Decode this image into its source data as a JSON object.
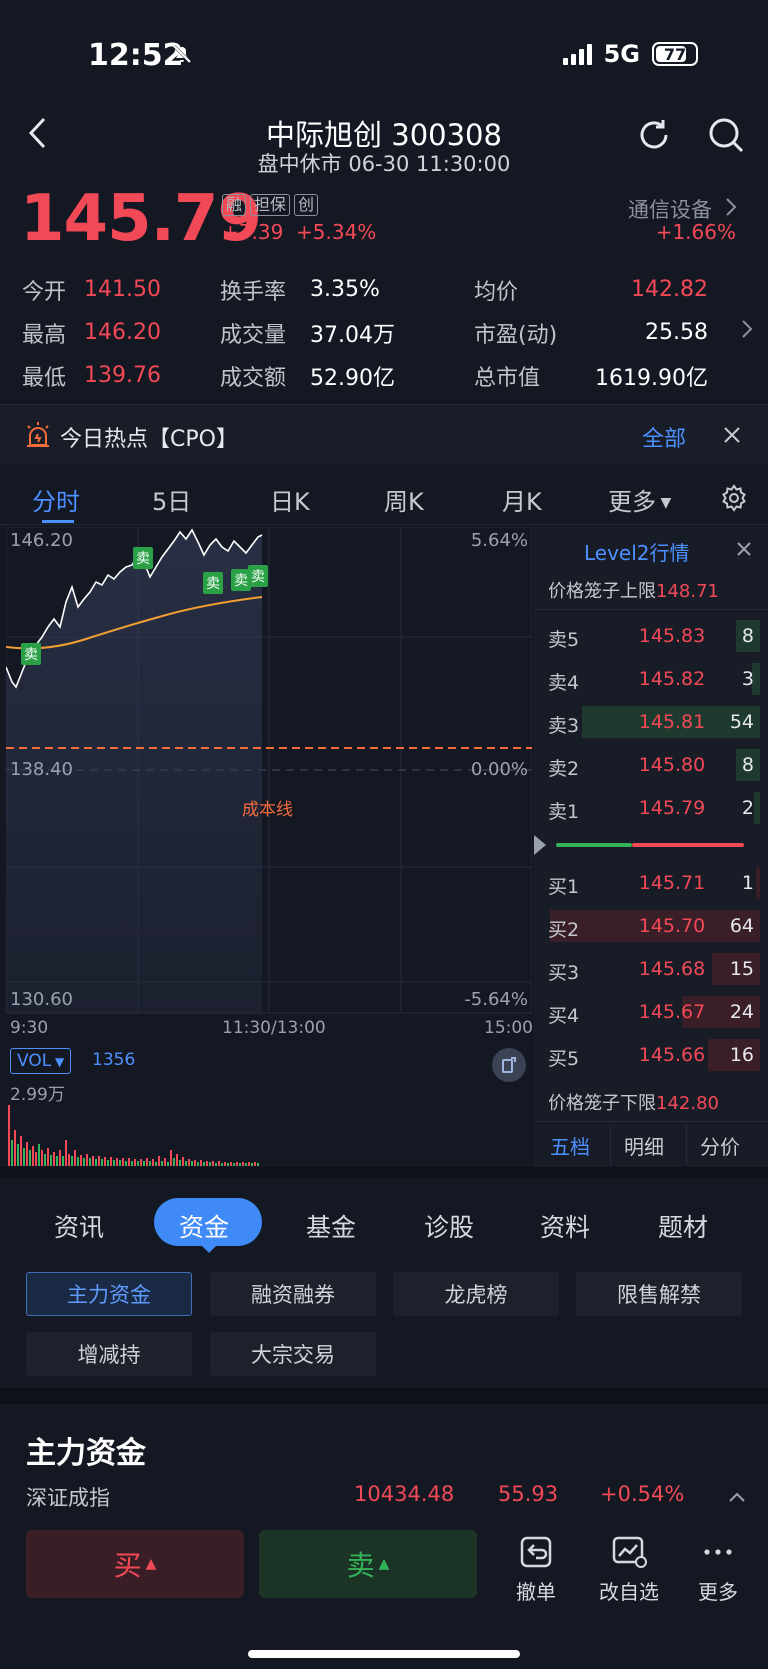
{
  "status": {
    "time": "12:52",
    "network": "5G",
    "battery": "77"
  },
  "header": {
    "title": "中际旭创 300308",
    "subtitle": "盘中休市 06-30 11:30:00"
  },
  "quote": {
    "price": "145.79",
    "badges": [
      "融",
      "担保",
      "创"
    ],
    "change": "+7.39",
    "change_pct": "+5.34%",
    "sector": "通信设备",
    "sector_chg": "+1.66%"
  },
  "stats": [
    [
      {
        "label": "今开",
        "value": "141.50",
        "color": "red"
      },
      {
        "label": "换手率",
        "value": "3.35%"
      },
      {
        "label": "均价",
        "value": "142.82",
        "color": "red"
      }
    ],
    [
      {
        "label": "最高",
        "value": "146.20",
        "color": "red"
      },
      {
        "label": "成交量",
        "value": "37.04万"
      },
      {
        "label": "市盈(动)",
        "value": "25.58"
      }
    ],
    [
      {
        "label": "最低",
        "value": "139.76",
        "color": "red"
      },
      {
        "label": "成交额",
        "value": "52.90亿"
      },
      {
        "label": "总市值",
        "value": "1619.90亿"
      }
    ]
  ],
  "hot": {
    "text": "今日热点【CPO】",
    "all": "全部"
  },
  "ktabs": [
    "分时",
    "5日",
    "日K",
    "周K",
    "月K",
    "更多"
  ],
  "chart": {
    "y_top": "146.20",
    "y_mid": "138.40",
    "y_bot": "130.60",
    "pct_top": "5.64%",
    "pct_mid": "0.00%",
    "pct_bot": "-5.64%",
    "t_start": "9:30",
    "t_mid": "11:30/13:00",
    "t_end": "15:00",
    "cost_line": "成本线",
    "sell_marker": "卖",
    "vol_label": "VOL",
    "vol_value": "1356",
    "vol_max": "2.99万"
  },
  "orderbook": {
    "title": "Level2行情",
    "upper_label": "价格笼子上限",
    "upper_value": "148.71",
    "lower_label": "价格笼子下限",
    "lower_value": "142.80",
    "asks": [
      {
        "label": "卖5",
        "price": "145.83",
        "qty": "8"
      },
      {
        "label": "卖4",
        "price": "145.82",
        "qty": "3"
      },
      {
        "label": "卖3",
        "price": "145.81",
        "qty": "54"
      },
      {
        "label": "卖2",
        "price": "145.80",
        "qty": "8"
      },
      {
        "label": "卖1",
        "price": "145.79",
        "qty": "2"
      }
    ],
    "bids": [
      {
        "label": "买1",
        "price": "145.71",
        "qty": "1"
      },
      {
        "label": "买2",
        "price": "145.70",
        "qty": "64"
      },
      {
        "label": "买3",
        "price": "145.68",
        "qty": "15"
      },
      {
        "label": "买4",
        "price": "145.67",
        "qty": "24"
      },
      {
        "label": "买5",
        "price": "145.66",
        "qty": "16"
      }
    ],
    "tabs": [
      "五档",
      "明细",
      "分价"
    ]
  },
  "section_tabs": [
    "资讯",
    "资金",
    "基金",
    "诊股",
    "资料",
    "题材"
  ],
  "sub_tabs": [
    "主力资金",
    "融资融券",
    "龙虎榜",
    "限售解禁",
    "增减持",
    "大宗交易"
  ],
  "main_fund": {
    "title": "主力资金"
  },
  "index": {
    "name": "深证成指",
    "value": "10434.48",
    "change": "55.93",
    "pct": "+0.54%"
  },
  "actions": {
    "buy": "买",
    "sell": "卖",
    "cancel": "撤单",
    "edit_watch": "改自选",
    "more": "更多"
  }
}
